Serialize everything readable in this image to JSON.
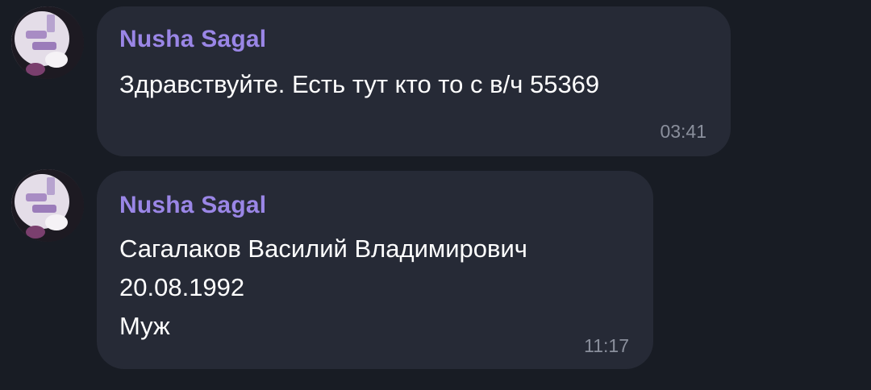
{
  "messages": [
    {
      "sender": "Nusha Sagal",
      "lines": [
        "Здравствуйте. Есть тут кто то с в/ч 55369"
      ],
      "time": "03:41",
      "avatar_icon": "user-avatar-photo"
    },
    {
      "sender": "Nusha Sagal",
      "lines": [
        "Сагалаков Василий Владимирович",
        "20.08.1992",
        "Муж"
      ],
      "time": "11:17",
      "avatar_icon": "user-avatar-photo"
    }
  ],
  "colors": {
    "background": "#181c24",
    "bubble": "#262a36",
    "sender_name": "#9a86e6",
    "message_text": "#ffffff",
    "timestamp": "#8a8f9c"
  }
}
